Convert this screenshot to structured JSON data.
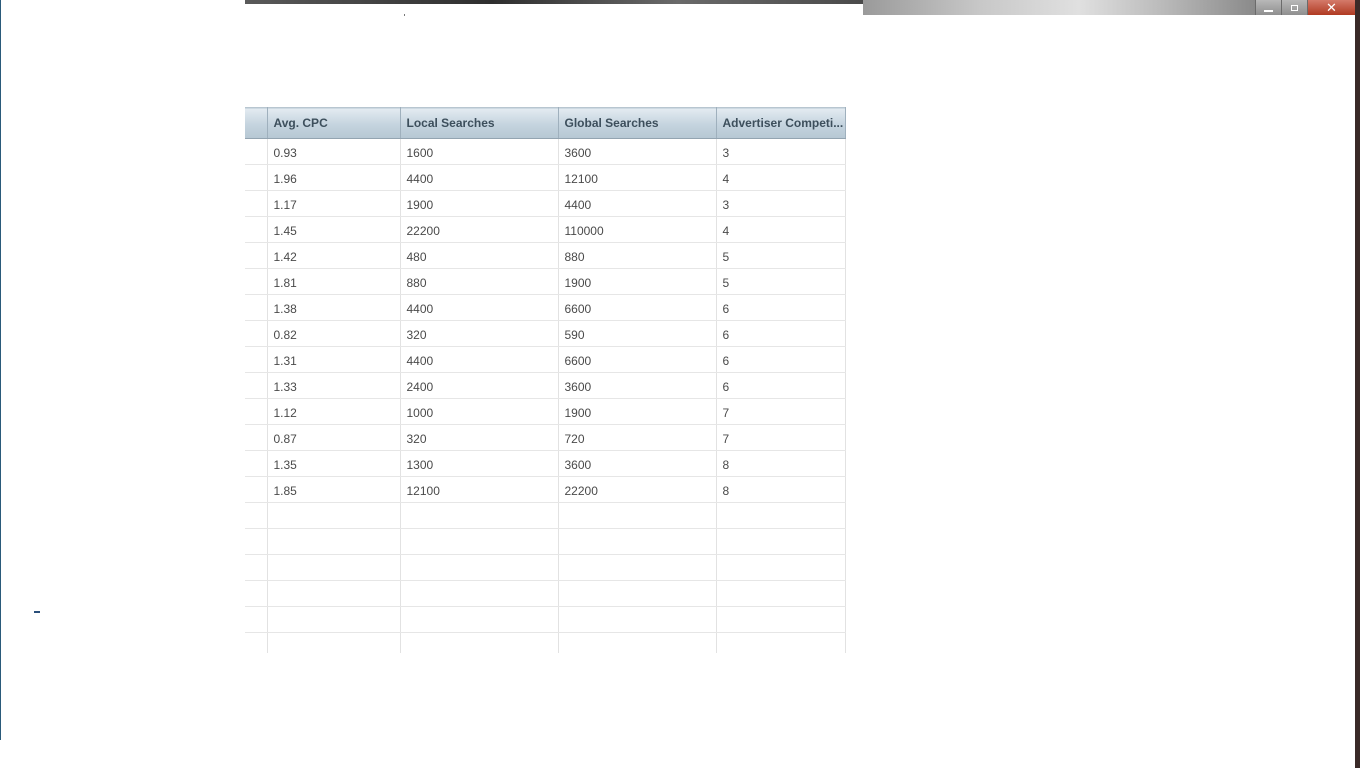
{
  "window": {
    "controls": {
      "minimize_icon": "minimize-icon",
      "maximize_icon": "restore-icon",
      "close_label": "✕"
    }
  },
  "table": {
    "columns": [
      "",
      "Avg. CPC",
      "Local Searches",
      "Global Searches",
      "Advertiser Competi..."
    ],
    "rows": [
      [
        "0.93",
        "1600",
        "3600",
        "3"
      ],
      [
        "1.96",
        "4400",
        "12100",
        "4"
      ],
      [
        "1.17",
        "1900",
        "4400",
        "3"
      ],
      [
        "1.45",
        "22200",
        "110000",
        "4"
      ],
      [
        "1.42",
        "480",
        "880",
        "5"
      ],
      [
        "1.81",
        "880",
        "1900",
        "5"
      ],
      [
        "1.38",
        "4400",
        "6600",
        "6"
      ],
      [
        "0.82",
        "320",
        "590",
        "6"
      ],
      [
        "1.31",
        "4400",
        "6600",
        "6"
      ],
      [
        "1.33",
        "2400",
        "3600",
        "6"
      ],
      [
        "1.12",
        "1000",
        "1900",
        "7"
      ],
      [
        "0.87",
        "320",
        "720",
        "7"
      ],
      [
        "1.35",
        "1300",
        "3600",
        "8"
      ],
      [
        "1.85",
        "12100",
        "22200",
        "8"
      ]
    ],
    "empty_rows": 6
  },
  "colors": {
    "header_gradient_top": "#e4ebf1",
    "header_gradient_bottom": "#b6c7d3",
    "close_button": "#b03a22"
  }
}
